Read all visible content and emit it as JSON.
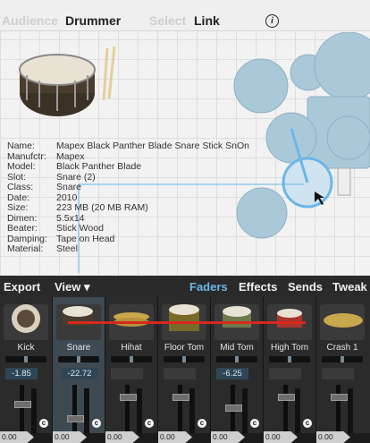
{
  "header": {
    "audience_label": "Audience",
    "drummer_label": "Drummer",
    "select_label": "Select",
    "link_label": "Link",
    "info_icon": "info-icon"
  },
  "instrument_info": {
    "rows": [
      {
        "key": "Name:",
        "value": "Mapex Black Panther Blade Snare Stick SnOn"
      },
      {
        "key": "Manufctr:",
        "value": "Mapex"
      },
      {
        "key": "Model:",
        "value": "Black Panther Blade"
      },
      {
        "key": "Slot:",
        "value": "Snare (2)"
      },
      {
        "key": "Class:",
        "value": "Snare"
      },
      {
        "key": "Date:",
        "value": "2010"
      },
      {
        "key": "Size:",
        "value": "223 MB (20 MB RAM)"
      },
      {
        "key": "Dimen:",
        "value": "5.5x14"
      },
      {
        "key": "Beater:",
        "value": "Stick Wood"
      },
      {
        "key": "Damping:",
        "value": "Tape on Head"
      },
      {
        "key": "Material:",
        "value": "Steel"
      }
    ]
  },
  "mixer_toolbar": {
    "export_label": "Export",
    "view_label": "View ▾",
    "faders_label": "Faders",
    "effects_label": "Effects",
    "sends_label": "Sends",
    "tweak_label": "Tweak"
  },
  "channels": [
    {
      "name": "Kick",
      "volume": "-1.85",
      "level": "0.00",
      "selected": false
    },
    {
      "name": "Snare",
      "volume": "-22.72",
      "level": "0.00",
      "selected": true
    },
    {
      "name": "Hihat",
      "volume": "",
      "level": "0.00",
      "selected": false
    },
    {
      "name": "Floor Tom",
      "volume": "",
      "level": "0.00",
      "selected": false
    },
    {
      "name": "Mid Tom",
      "volume": "-6.25",
      "level": "0.00",
      "selected": false
    },
    {
      "name": "High Tom",
      "volume": "",
      "level": "0.00",
      "selected": false
    },
    {
      "name": "Crash 1",
      "volume": "",
      "level": "0.00",
      "selected": false
    }
  ],
  "colors": {
    "accent_blue": "#6bb6e8",
    "drum_kit_blue": "#a9c9d9",
    "link_red": "#d8281e"
  }
}
